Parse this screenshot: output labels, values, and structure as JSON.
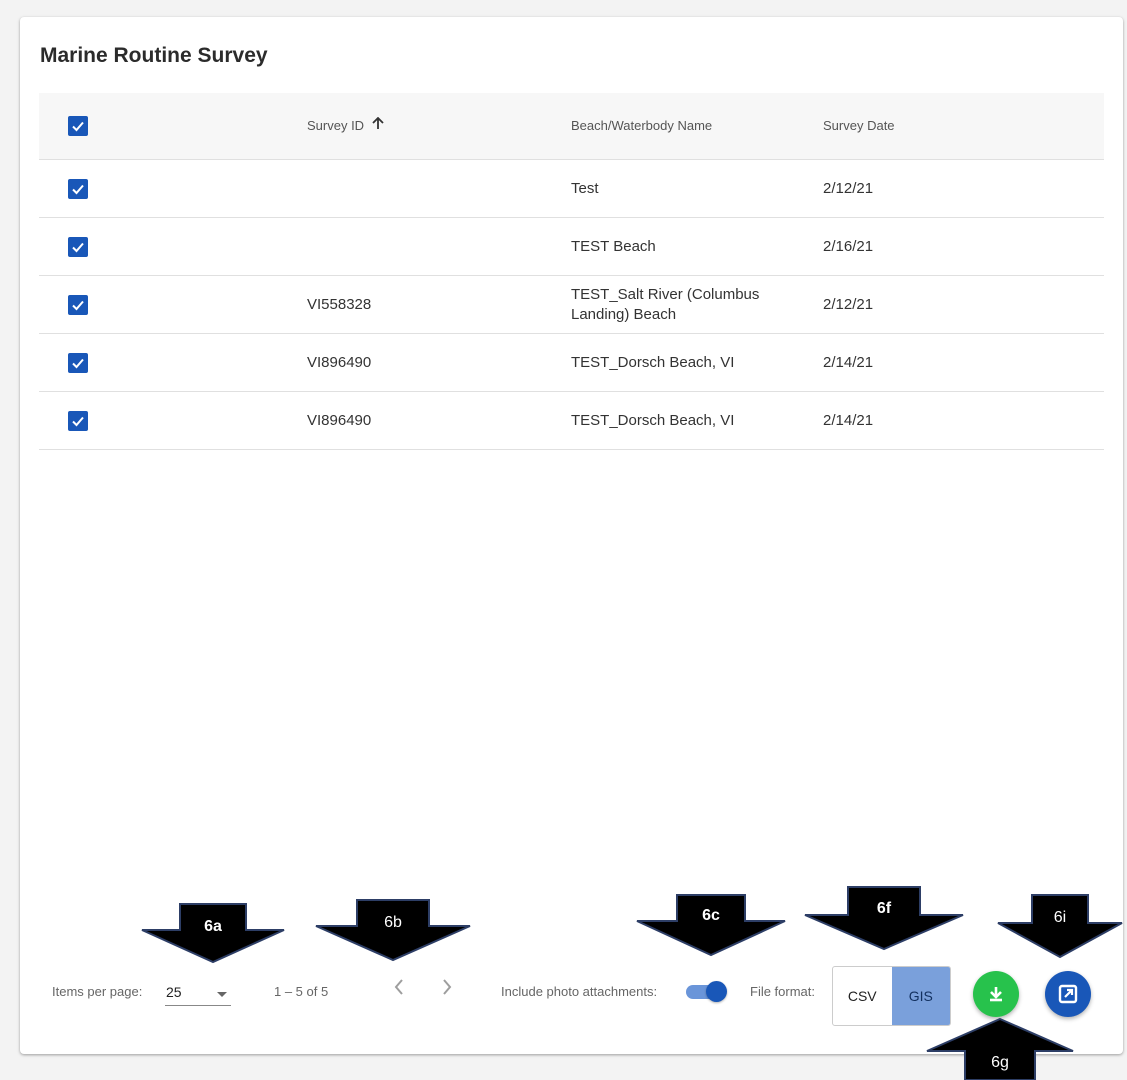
{
  "page": {
    "title": "Marine Routine Survey"
  },
  "table": {
    "headers": {
      "survey_id": "Survey ID",
      "beach_name": "Beach/Waterbody Name",
      "survey_date": "Survey Date"
    },
    "rows": [
      {
        "survey_id": "",
        "beach_name": "Test",
        "survey_date": "2/12/21"
      },
      {
        "survey_id": "",
        "beach_name": "TEST Beach",
        "survey_date": "2/16/21"
      },
      {
        "survey_id": "VI558328",
        "beach_name": "TEST_Salt River (Columbus Landing) Beach",
        "survey_date": "2/12/21"
      },
      {
        "survey_id": "VI896490",
        "beach_name": "TEST_Dorsch Beach, VI",
        "survey_date": "2/14/21"
      },
      {
        "survey_id": "VI896490",
        "beach_name": "TEST_Dorsch Beach, VI",
        "survey_date": "2/14/21"
      }
    ]
  },
  "footer": {
    "items_per_page_label": "Items per page:",
    "items_per_page_value": "25",
    "range_label": "1 – 5 of 5",
    "include_photos_label": "Include photo attachments:",
    "include_photos_on": true,
    "file_format_label": "File format:",
    "formats": [
      "CSV",
      "GIS"
    ],
    "selected_format": "GIS"
  },
  "callouts": {
    "a": "6a",
    "b": "6b",
    "c": "6c",
    "f": "6f",
    "i": "6i",
    "g": "6g"
  },
  "colors": {
    "primary": "#1957b8",
    "download": "#27c24c",
    "selected_format_bg": "#7aa0db"
  },
  "icons": {
    "sort": "arrow-up-icon",
    "download": "download-icon",
    "export": "export-icon"
  }
}
